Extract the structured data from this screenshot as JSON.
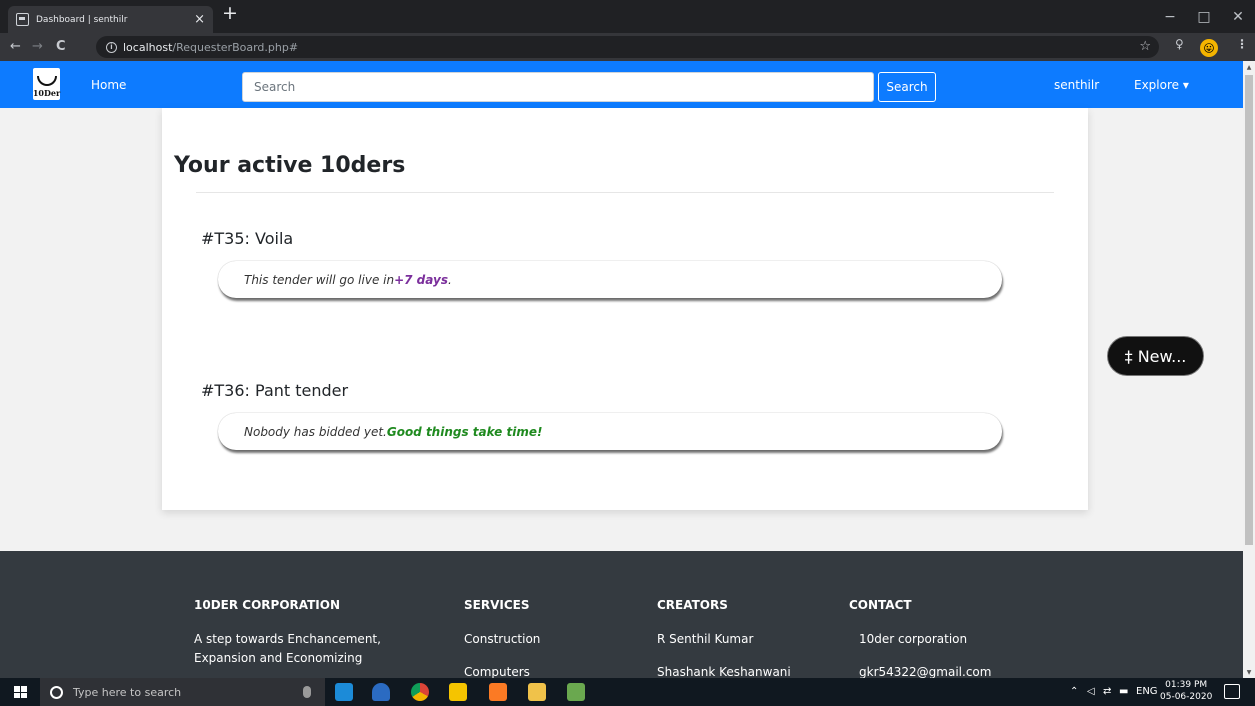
{
  "browser": {
    "tab_title": "Dashboard | senthilr",
    "tab_close": "×",
    "new_tab": "+",
    "url_host": "localhost",
    "url_path": "/RequesterBoard.php#",
    "back": "←",
    "forward": "→",
    "reload": "C",
    "info": "i",
    "bookmark_star": "☆",
    "window_minimize": "−",
    "window_maximize": "□",
    "window_close": "✕",
    "avatar_emoji": "😛",
    "menu": "⋮",
    "ext_icon": "♀"
  },
  "navbar": {
    "logo_text": "10Der",
    "home": "Home",
    "search_placeholder": "Search",
    "search_button": "Search",
    "user": "senthilr",
    "explore": "Explore ▾"
  },
  "main": {
    "title": "Your active 10ders",
    "tenders": [
      {
        "title": "#T35: Voila",
        "status_prefix": "This tender will go live in ",
        "status_highlight": "+7 days",
        "status_suffix": " ."
      },
      {
        "title": "#T36: Pant tender",
        "status_prefix": "Nobody has bidded yet. ",
        "status_highlight": "Good things take time!",
        "status_suffix": ""
      }
    ],
    "new_button": "‡ New..."
  },
  "footer": {
    "columns": [
      {
        "heading": "10DER CORPORATION",
        "lines": [
          "A step towards Enchancement,",
          "Expansion and Economizing"
        ]
      },
      {
        "heading": "SERVICES",
        "lines": [
          "Construction",
          "Computers"
        ]
      },
      {
        "heading": "CREATORS",
        "lines": [
          "R Senthil Kumar",
          "Shashank Keshanwani"
        ]
      },
      {
        "heading": "CONTACT",
        "lines": [
          "10der corporation",
          "gkr54322@gmail.com"
        ]
      }
    ]
  },
  "taskbar": {
    "search_placeholder": "Type here to search",
    "tray_chevron": "⌃",
    "tray_language": "ENG",
    "time": "01:39 PM",
    "date": "05-06-2020"
  }
}
